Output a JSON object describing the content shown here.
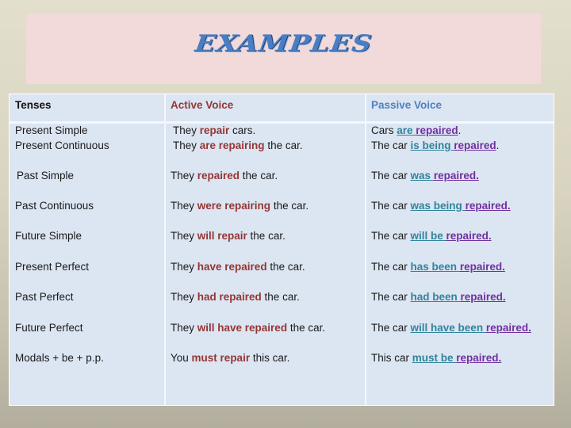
{
  "title": "EXAMPLES",
  "colors": {
    "active_verb": "#943634",
    "passive_auxiliary": "#31849B",
    "passive_participle": "#7030A0",
    "passive_header": "#4F81BD",
    "title": "#4A7EC4"
  },
  "table": {
    "headers": {
      "tenses": "Tenses",
      "active": "Active Voice",
      "passive": "Passive Voice"
    },
    "rows": [
      {
        "tense": [
          "Present Simple",
          "Present Continuous"
        ],
        "active": [
          {
            "pre": "They ",
            "verb": "repair",
            "post": " cars."
          },
          {
            "pre": "They ",
            "verb": "are repairing",
            "post": " the car."
          }
        ],
        "passive": [
          {
            "pre": "Cars ",
            "aux": "are",
            "pp": "repaired",
            "post": "."
          },
          {
            "pre": "The car ",
            "aux": "is being",
            "pp": "repaired",
            "post": "."
          }
        ]
      },
      {
        "tense": [
          "Past Simple"
        ],
        "active": [
          {
            "pre": "They ",
            "verb": "repaired",
            "post": " the car."
          }
        ],
        "passive": [
          {
            "pre": "The car ",
            "aux": "was",
            "pp": "repaired.",
            "post": ""
          }
        ]
      },
      {
        "tense": [
          "Past Continuous"
        ],
        "active": [
          {
            "pre": "They ",
            "verb": "were repairing",
            "post": " the car."
          }
        ],
        "passive": [
          {
            "pre": "The car ",
            "aux": "was being",
            "pp": "repaired.",
            "post": ""
          }
        ]
      },
      {
        "tense": [
          "Future Simple"
        ],
        "active": [
          {
            "pre": "They ",
            "verb": "will repair",
            "post": " the car."
          }
        ],
        "passive": [
          {
            "pre": "The car ",
            "aux": "will be",
            "pp": "repaired.",
            "post": ""
          }
        ]
      },
      {
        "tense": [
          "Present Perfect"
        ],
        "active": [
          {
            "pre": "They ",
            "verb": "have repaired",
            "post": " the car."
          }
        ],
        "passive": [
          {
            "pre": "The car ",
            "aux": "has been",
            "pp": "repaired.",
            "post": ""
          }
        ]
      },
      {
        "tense": [
          "Past Perfect"
        ],
        "active": [
          {
            "pre": "They ",
            "verb": "had repaired",
            "post": " the car."
          }
        ],
        "passive": [
          {
            "pre": "The car ",
            "aux": "had been",
            "pp": "repaired.",
            "post": ""
          }
        ]
      },
      {
        "tense": [
          "Future Perfect"
        ],
        "active": [
          {
            "pre": "They ",
            "verb": "will have repaired",
            "post": " the car."
          }
        ],
        "passive": [
          {
            "pre": "The car ",
            "aux": "will have been",
            "pp": "repaired.",
            "post": ""
          }
        ]
      },
      {
        "tense": [
          "Modals + be + p.p."
        ],
        "active": [
          {
            "pre": "You ",
            "verb": "must repair",
            "post": " this car."
          }
        ],
        "passive": [
          {
            "pre": "This car ",
            "aux": "must be",
            "pp": "repaired.",
            "post": ""
          }
        ]
      }
    ]
  }
}
